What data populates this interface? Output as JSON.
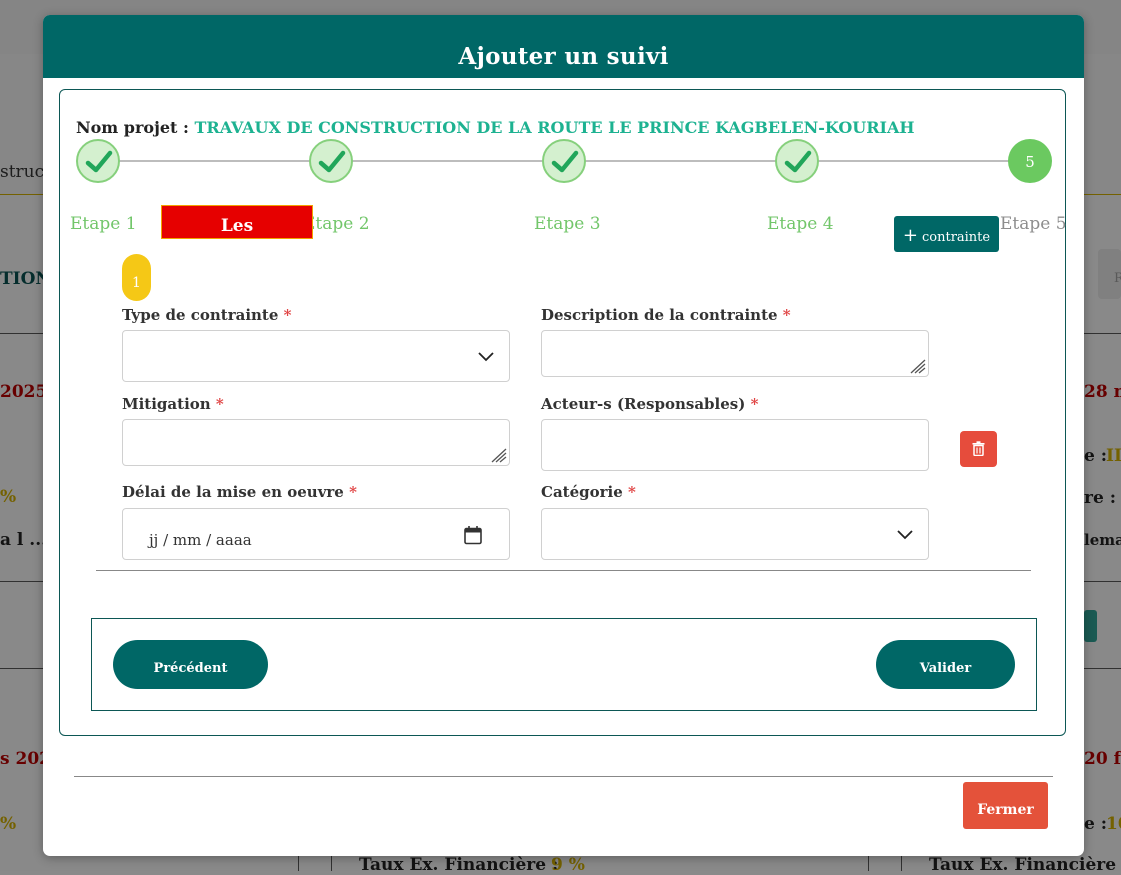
{
  "modal": {
    "title": "Ajouter un suivi",
    "project_label": "Nom projet :",
    "project_name": "TRAVAUX DE CONSTRUCTION DE LA ROUTE LE PRINCE KAGBELEN-KOURIAH"
  },
  "stepper": {
    "steps": [
      {
        "label": "Etape 1",
        "status": "done"
      },
      {
        "label": "Etape 2",
        "status": "done"
      },
      {
        "label": "Etape 3",
        "status": "done"
      },
      {
        "label": "Etape 4",
        "status": "done"
      },
      {
        "label": "Etape 5",
        "status": "current",
        "number": "5"
      }
    ]
  },
  "section": {
    "tag": "Les Contraintes",
    "add_button_plus": "+",
    "add_button_label": "contrainte",
    "item_number": "1"
  },
  "form": {
    "type_label": "Type de contrainte",
    "description_label": "Description de la contrainte",
    "mitigation_label": "Mitigation",
    "acteurs_label": "Acteur-s (Responsables)",
    "delai_label": "Délai de la mise en oeuvre",
    "categorie_label": "Catégorie",
    "required_mark": "*",
    "date_placeholder": "jj / mm / aaaa"
  },
  "buttons": {
    "previous": "Précédent",
    "validate": "Valider",
    "close": "Fermer"
  },
  "background": {
    "fragment_construct": "structi",
    "fragment_tion": "TION",
    "fragment_date_left_1": "2025",
    "fragment_pct_left": "%",
    "fragment_ellipsis": "a l ...",
    "fragment_date_left_2": "s 2025",
    "fragment_pct_left_2": "%",
    "fragment_right_1": "28 m",
    "fragment_right_e": "e :",
    "fragment_right_ii": "II",
    "fragment_right_re": "re :",
    "fragment_right_lema": "lema",
    "fragment_right_2": "20 fé",
    "fragment_right_e2": "e :",
    "fragment_right_10": "10",
    "fragment_r_box": "R",
    "fragment_taux_left": "Taux Ex. Financière :",
    "fragment_taux_left_val": "9 %",
    "fragment_taux_right": "Taux Ex. Financière :"
  },
  "colors": {
    "primary": "#006766",
    "accent_green": "#1db291",
    "step_done": "#86d07c",
    "danger": "#e4523a",
    "tag_red": "#e60000",
    "badge_yellow": "#f5c816"
  }
}
